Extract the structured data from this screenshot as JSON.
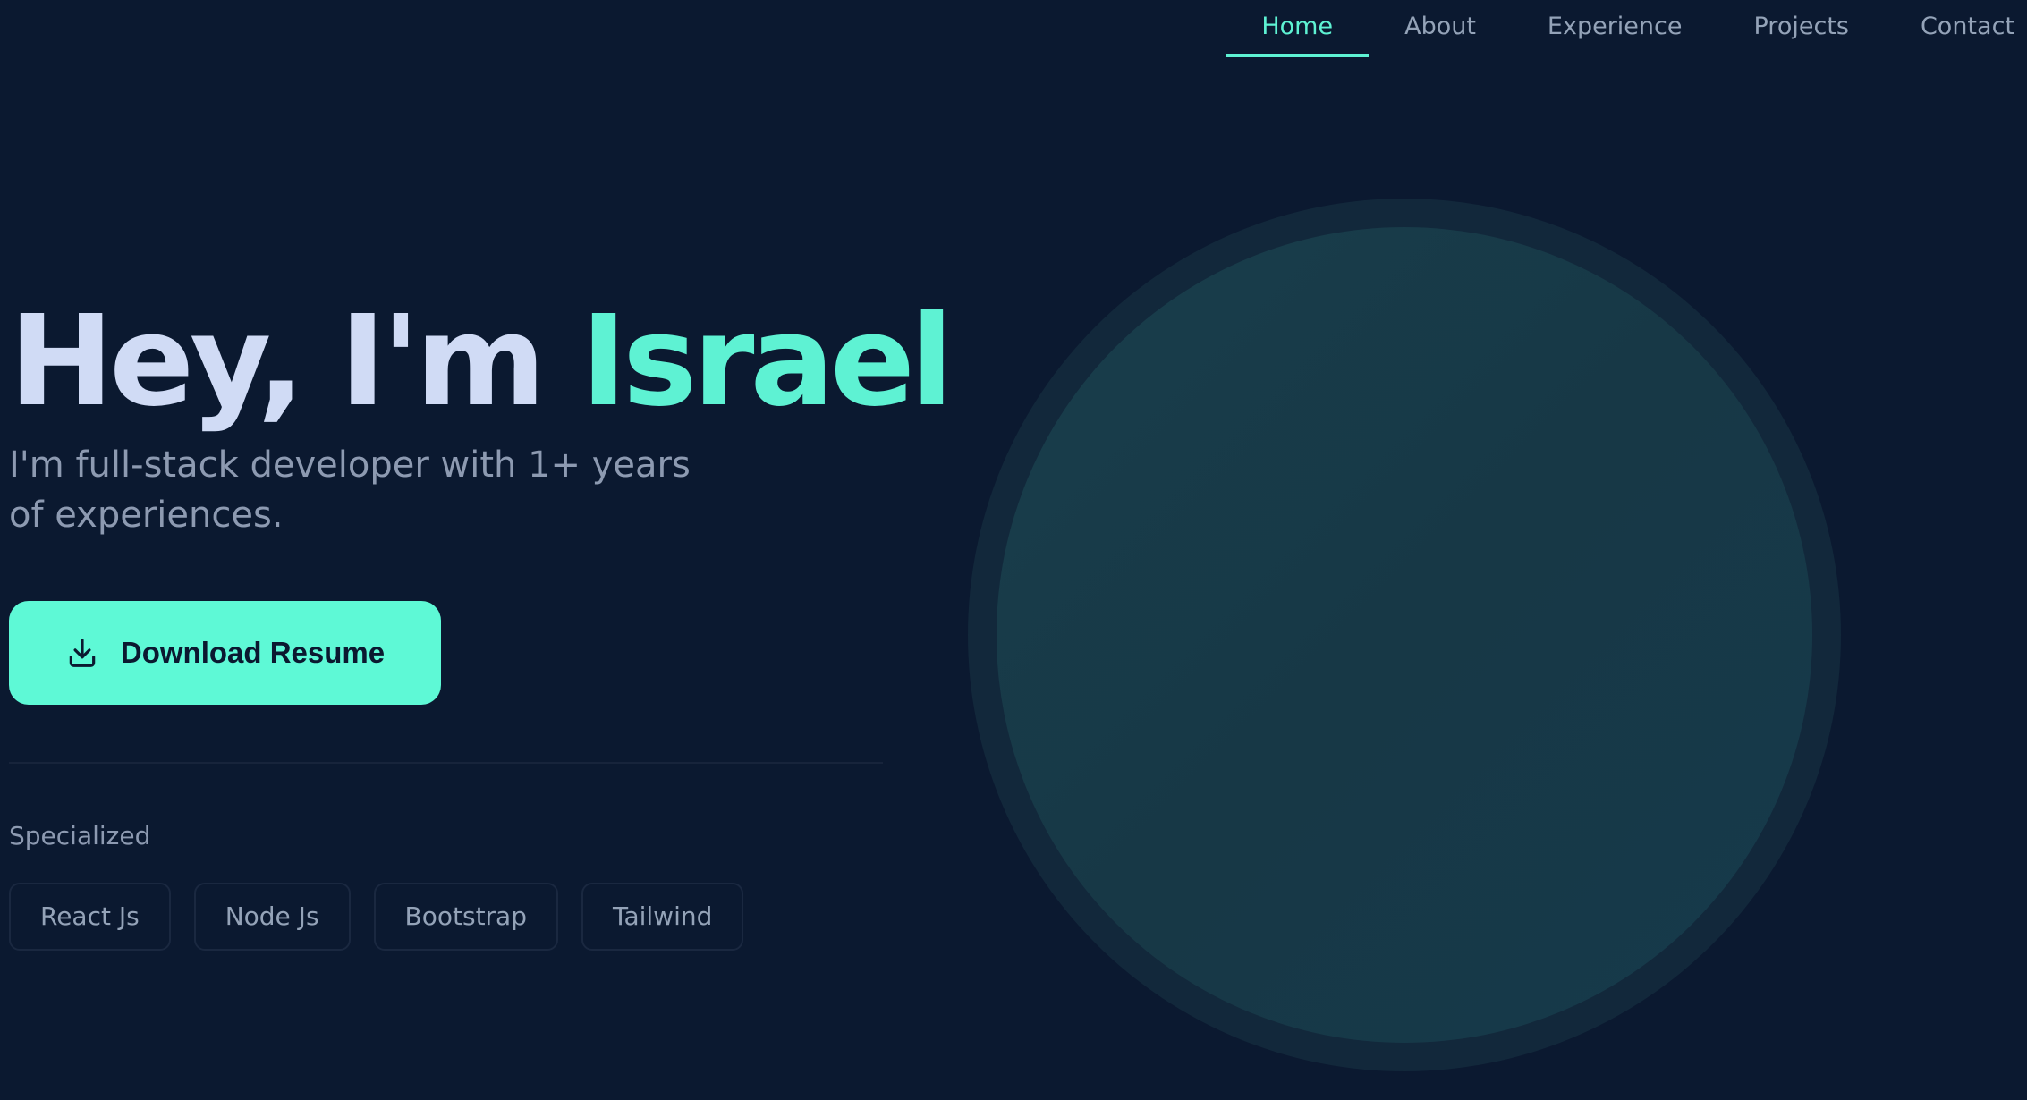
{
  "nav": {
    "items": [
      {
        "label": "Home",
        "active": true
      },
      {
        "label": "About",
        "active": false
      },
      {
        "label": "Experience",
        "active": false
      },
      {
        "label": "Projects",
        "active": false
      },
      {
        "label": "Contact",
        "active": false
      }
    ]
  },
  "hero": {
    "title_prefix": "Hey, I'm ",
    "title_name": "Israel",
    "subtitle": "I'm full-stack developer with 1+ years of experiences.",
    "download_button": {
      "label": "Download Resume",
      "icon": "download-icon"
    },
    "specialized_label": "Specialized",
    "skills": [
      "React Js",
      "Node Js",
      "Bootstrap",
      "Tailwind"
    ]
  },
  "colors": {
    "background": "#0b1930",
    "accent": "#5ef2d3",
    "title": "#d0dbf5",
    "muted_text": "#8d9ab1"
  }
}
